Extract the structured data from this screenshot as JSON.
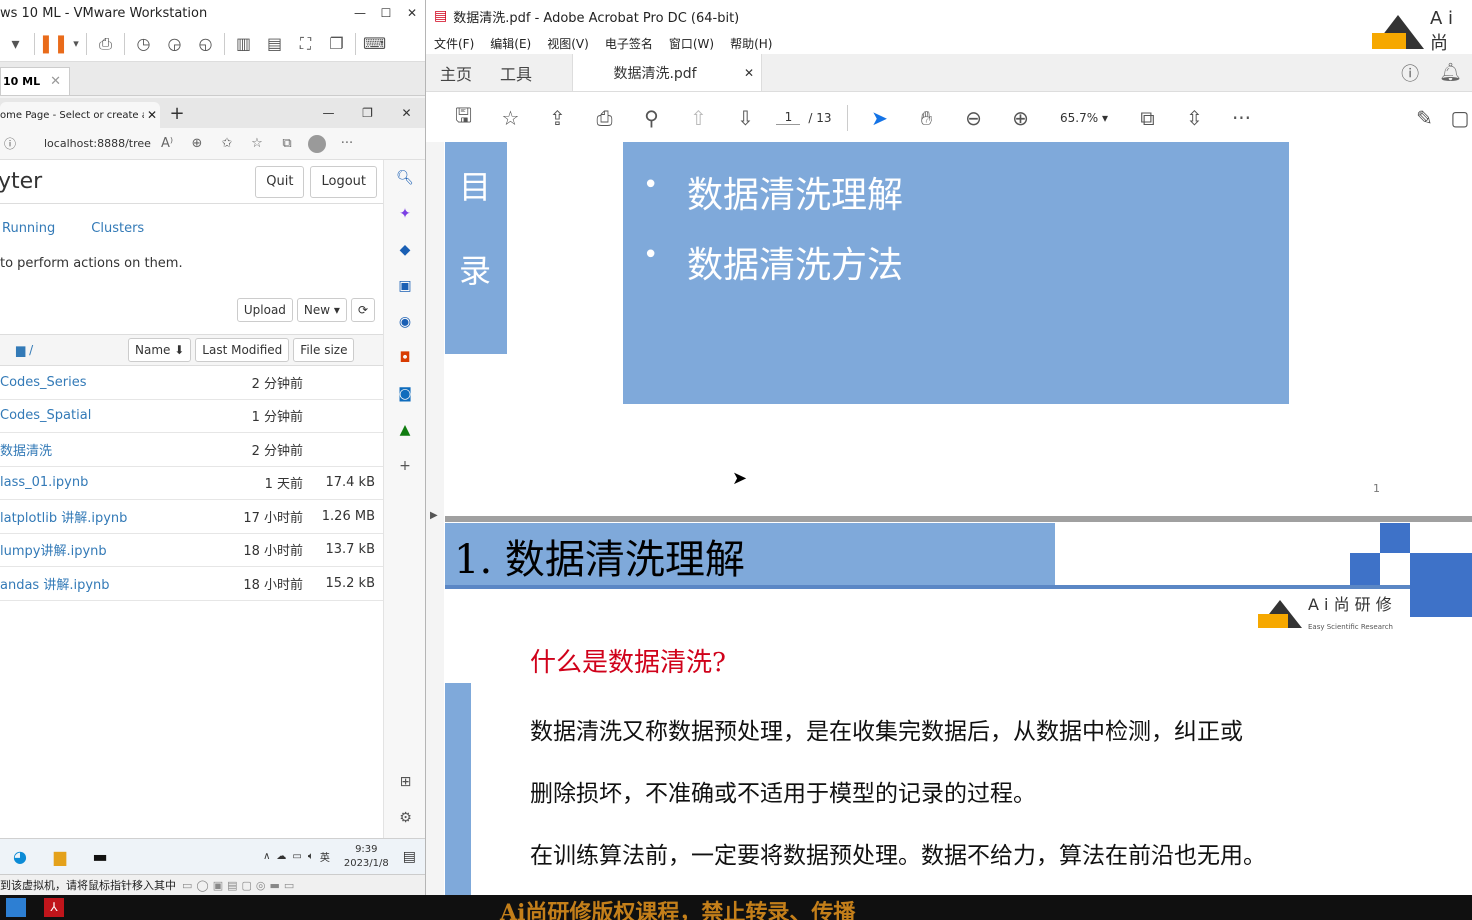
{
  "vmware": {
    "title": "ws 10 ML - VMware Workstation",
    "tab_label": "10 ML",
    "status_text": "到该虚拟机，请将鼠标指针移入其中"
  },
  "browser": {
    "tab_label": "ome Page - Select or create a n",
    "url": "localhost:8888/tree"
  },
  "jupyter": {
    "logo": "yter",
    "quit": "Quit",
    "logout": "Logout",
    "nav": [
      "Running",
      "Clusters"
    ],
    "hint": "to perform actions on them.",
    "upload": "Upload",
    "new": "New ▾",
    "refresh": "⟳",
    "folder": "/",
    "col_name": "Name ⬇",
    "col_modified": "Last Modified",
    "col_size": "File size",
    "rows": [
      {
        "name": "Codes_Series",
        "time": "2 分钟前",
        "size": ""
      },
      {
        "name": "Codes_Spatial",
        "time": "1 分钟前",
        "size": ""
      },
      {
        "name": "数据清洗",
        "time": "2 分钟前",
        "size": ""
      },
      {
        "name": "lass_01.ipynb",
        "time": "1 天前",
        "size": "17.4 kB"
      },
      {
        "name": "latplotlib 讲解.ipynb",
        "time": "17 小时前",
        "size": "1.26 MB"
      },
      {
        "name": "lumpy讲解.ipynb",
        "time": "18 小时前",
        "size": "13.7 kB"
      },
      {
        "name": "andas 讲解.ipynb",
        "time": "18 小时前",
        "size": "15.2 kB"
      }
    ]
  },
  "taskbar": {
    "lang": "英",
    "time": "9:39",
    "date": "2023/1/8"
  },
  "acrobat": {
    "title": "数据清洗.pdf - Adobe Acrobat Pro DC (64-bit)",
    "menu": [
      "文件(F)",
      "编辑(E)",
      "视图(V)",
      "电子签名",
      "窗口(W)",
      "帮助(H)"
    ],
    "nav_home": "主页",
    "nav_tools": "工具",
    "doc_tab": "数据清洗.pdf",
    "page_current": "1",
    "page_total": "/ 13",
    "zoom": "65.7%",
    "logo_text": "A i 尚"
  },
  "slide1": {
    "side_chars": [
      "目",
      "录"
    ],
    "items": [
      "数据清洗理解",
      "数据清洗方法"
    ],
    "page_number": "1"
  },
  "slide2": {
    "title": "1. 数据清洗理解",
    "logo_text": "A i 尚 研 修",
    "logo_sub": "Easy Scientific Research",
    "question": "什么是数据清洗?",
    "paragraphs": [
      "数据清洗又称数据预处理，是在收集完数据后，从数据中检测，纠正或",
      "删除损坏，不准确或不适用于模型的记录的过程。",
      "在训练算法前，一定要将数据预处理。数据不给力，算法在前沿也无用。"
    ]
  },
  "banner": "Ai尚研修版权课程，禁止转录、传播"
}
